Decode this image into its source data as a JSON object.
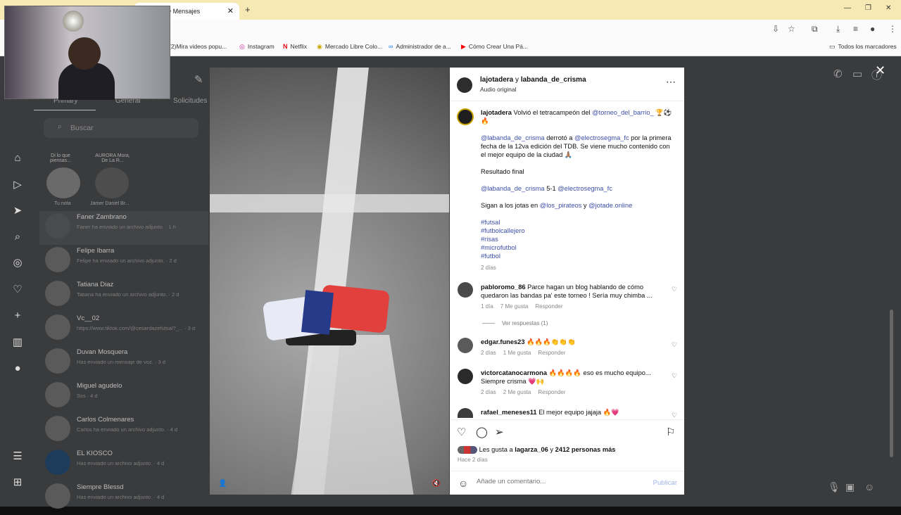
{
  "browser": {
    "tab_title": "• Mensajes",
    "bookmarks": [
      "(2)Mira videos popu...",
      "Instagram",
      "Netflix",
      "Mercado Libre Colo...",
      "Administrador de a...",
      "Cómo Crear Una Pá..."
    ],
    "all_bookmarks": "Todos los marcadores"
  },
  "inbox": {
    "tabs": [
      "Primary",
      "General",
      "Solicitudes"
    ],
    "search_placeholder": "Buscar",
    "notes": [
      {
        "text": "Di lo que piensas...",
        "label": "Tu nota"
      },
      {
        "text": "AURORA Mora, De La R...",
        "label": "Jamer Daniel Br..."
      }
    ],
    "chats": [
      {
        "name": "Faner Zambrano",
        "preview": "Faner ha enviado un archivo adjunto. · 1 h"
      },
      {
        "name": "Felipe Ibarra",
        "preview": "Felipe ha enviado un archivo adjunto. · 2 d"
      },
      {
        "name": "Tatiana Diaz",
        "preview": "Tatiana ha enviado un archivo adjunto. · 2 d"
      },
      {
        "name": "Vc__02",
        "preview": "https://www.tiktok.com/@cesardazefutsal?_... · 3 d"
      },
      {
        "name": "Duvan Mosquera",
        "preview": "Has enviado un mensaje de voz. · 3 d"
      },
      {
        "name": "Miguel agudelo",
        "preview": "Sss · 4 d"
      },
      {
        "name": "Carlos Colmenares",
        "preview": "Carlos ha enviado un archivo adjunto. · 4 d"
      },
      {
        "name": "EL KIOSCO",
        "preview": "Has enviado un archivo adjunto. · 4 d"
      },
      {
        "name": "Siempre Blessd",
        "preview": "Has enviado un archivo adjunto. · 4 d"
      }
    ]
  },
  "post": {
    "header_user1": "lajotadera",
    "header_and": " y ",
    "header_user2": "labanda_de_crisma",
    "audio": "Audio original",
    "caption_user": "lajotadera",
    "caption_line1": "Volvió el tetracampeón del",
    "caption_mention1": "@torneo_del_barrio_",
    "p2_mention1": "@labanda_de_crisma",
    "p2_text1": "derrotó a",
    "p2_mention2": "@electrosegma_fc",
    "p2_text2": "por la primera fecha de la 12va edición del TDB. Se viene mucho contenido con el mejor equipo de la ciudad 🙏🏽",
    "p3": "Resultado final",
    "p4_mention1": "@labanda_de_crisma",
    "p4_score": "5-1",
    "p4_mention2": "@electrosegma_fc",
    "p5_text": "Sigan a los jotas en",
    "p5_mention1": "@los_pirateos",
    "p5_and": "y",
    "p5_mention2": "@jotade.online",
    "hashtags": [
      "#futsal",
      "#futbolcallejero",
      "#risas",
      "#microfutbol",
      "#futbol"
    ],
    "caption_age": "2 días",
    "comments": [
      {
        "user": "pabloromo_86",
        "text": "Parce hagan un blog hablando de cómo quedaron las bandas pa' este torneo ! Sería muy chimba ...",
        "age": "1 día",
        "likes": "7 Me gusta",
        "reply": "Responder"
      },
      {
        "user": "edgar.funes23",
        "text": "🔥🔥🔥👏👏👏",
        "age": "2 días",
        "likes": "1 Me gusta",
        "reply": "Responder"
      },
      {
        "user": "victorcatanocarmona",
        "text": "🔥🔥🔥🔥 eso es mucho equipo... Siempre crisma 💗🙌",
        "age": "2 días",
        "likes": "2 Me gusta",
        "reply": "Responder"
      },
      {
        "user": "rafael_meneses11",
        "text": "El mejor equipo jajaja 🔥💗"
      }
    ],
    "view_replies": "Ver respuestas (1)",
    "likes_prefix": "Les gusta a",
    "likes_user": "lagarza_06",
    "likes_mid": "y",
    "likes_count": "2412 personas más",
    "posted_ago": "Hace 2 días",
    "comment_placeholder": "Añade un comentario...",
    "publish": "Publicar"
  }
}
